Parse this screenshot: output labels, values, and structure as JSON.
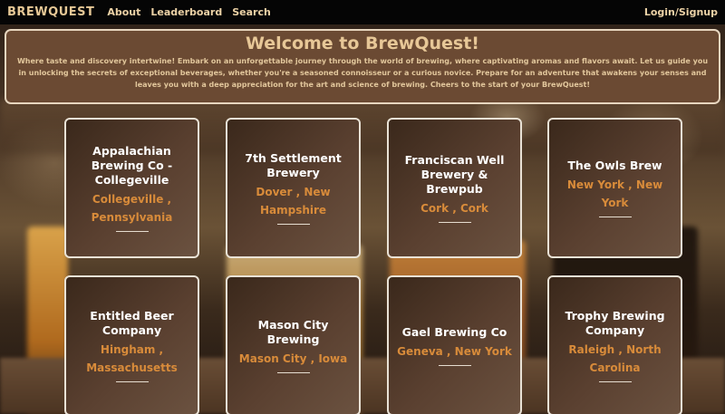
{
  "nav": {
    "brand": "BREWQUEST",
    "links": [
      "About",
      "Leaderboard",
      "Search"
    ],
    "login": "Login/Signup"
  },
  "welcome": {
    "title": "Welcome to BrewQuest!",
    "text": "Where taste and discovery intertwine! Embark on an unforgettable journey through the world of brewing, where captivating aromas and flavors await. Let us guide you in unlocking the secrets of exceptional beverages, whether you're a seasoned connoisseur or a curious novice. Prepare for an adventure that awakens your senses and leaves you with a deep appreciation for the art and science of brewing. Cheers to the start of your BrewQuest!"
  },
  "breweries": [
    {
      "name": "Appalachian Brewing Co - Collegeville",
      "location": "Collegeville , Pennsylvania"
    },
    {
      "name": "7th Settlement Brewery",
      "location": "Dover , New Hampshire"
    },
    {
      "name": "Franciscan Well Brewery & Brewpub",
      "location": "Cork , Cork"
    },
    {
      "name": "The Owls Brew",
      "location": "New York , New York"
    },
    {
      "name": "Entitled Beer Company",
      "location": "Hingham , Massachusetts"
    },
    {
      "name": "Mason City Brewing",
      "location": "Mason City , Iowa"
    },
    {
      "name": "Gael Brewing Co",
      "location": "Geneva , New York"
    },
    {
      "name": "Trophy Brewing Company",
      "location": "Raleigh , North Carolina"
    }
  ]
}
